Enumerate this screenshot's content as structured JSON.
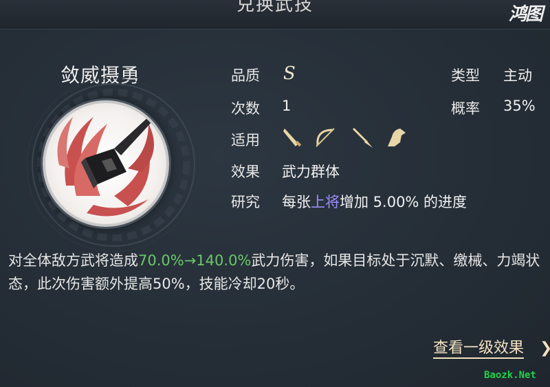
{
  "header": {
    "title": "兑换武技",
    "logo_text": "鸿图"
  },
  "skill": {
    "name": "敛威摄勇",
    "quality_label": "品质",
    "quality_value": "S",
    "type_label": "类型",
    "type_value": "主动",
    "count_label": "次数",
    "count_value": "1",
    "rate_label": "概率",
    "rate_value": "35%",
    "applies_label": "适用",
    "applies_icons": [
      "sword-icon",
      "bow-icon",
      "spear-icon",
      "horse-icon"
    ],
    "effect_label": "效果",
    "effect_value": "武力群体",
    "research_label": "研究",
    "research_prefix": "每张",
    "research_highlight": "上将",
    "research_suffix": "增加 5.00% 的进度",
    "description": {
      "part1": "对全体敌方武将造成",
      "damage_range": "70.0%→140.0%",
      "part2": "武力伤害，如果目标处于沉默、缴械、力竭状态，此次伤害额外提高50%，技能冷却20秒。"
    }
  },
  "footer": {
    "more_label": "查看一级效果",
    "more_arrow": "❯"
  },
  "watermark": "Baozk.Net",
  "colors": {
    "highlight_purple": "#9d8cff",
    "highlight_green": "#6ac86a",
    "link": "#f3e2c0"
  }
}
